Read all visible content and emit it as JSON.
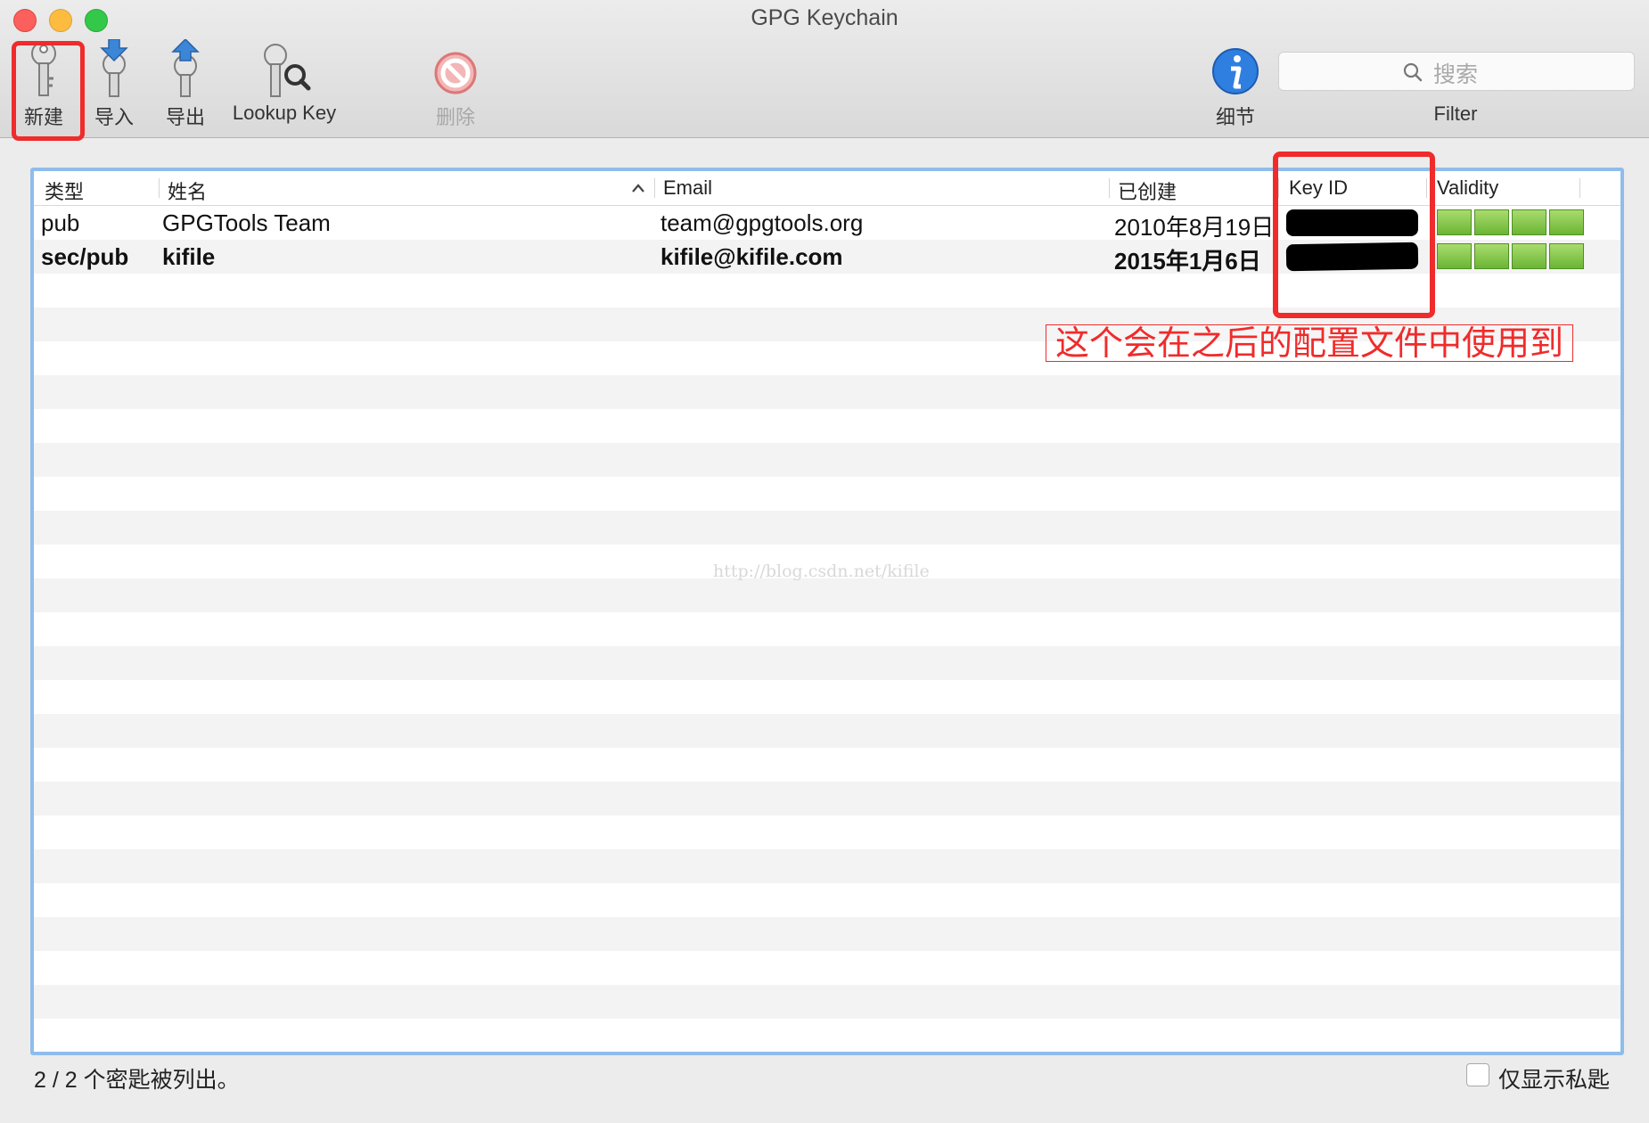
{
  "window": {
    "title": "GPG Keychain"
  },
  "toolbar": {
    "new_label": "新建",
    "import_label": "导入",
    "export_label": "导出",
    "lookup_label": "Lookup Key",
    "delete_label": "删除",
    "details_label": "细节"
  },
  "search": {
    "placeholder": "搜索",
    "label": "Filter"
  },
  "table": {
    "columns": [
      "类型",
      "姓名",
      "Email",
      "已创建",
      "Key ID",
      "Validity"
    ],
    "rows": [
      {
        "type": "pub",
        "name": "GPGTools Team",
        "email": "team@gpgtools.org",
        "created": "2010年8月19日",
        "bold": false,
        "validity": "full"
      },
      {
        "type": "sec/pub",
        "name": "kifile",
        "email": "kifile@kifile.com",
        "created": "2015年1月6日",
        "bold": true,
        "validity": "full"
      }
    ]
  },
  "annotation": {
    "text": "这个会在之后的配置文件中使用到"
  },
  "watermark": "http://blog.csdn.net/kifile",
  "status": {
    "text": "2 / 2 个密匙被列出。",
    "secret_only_label": "仅显示私匙"
  },
  "colors": {
    "accent": "#8fbdeb",
    "highlight": "#f02b2b",
    "validity": "#7cc043"
  }
}
